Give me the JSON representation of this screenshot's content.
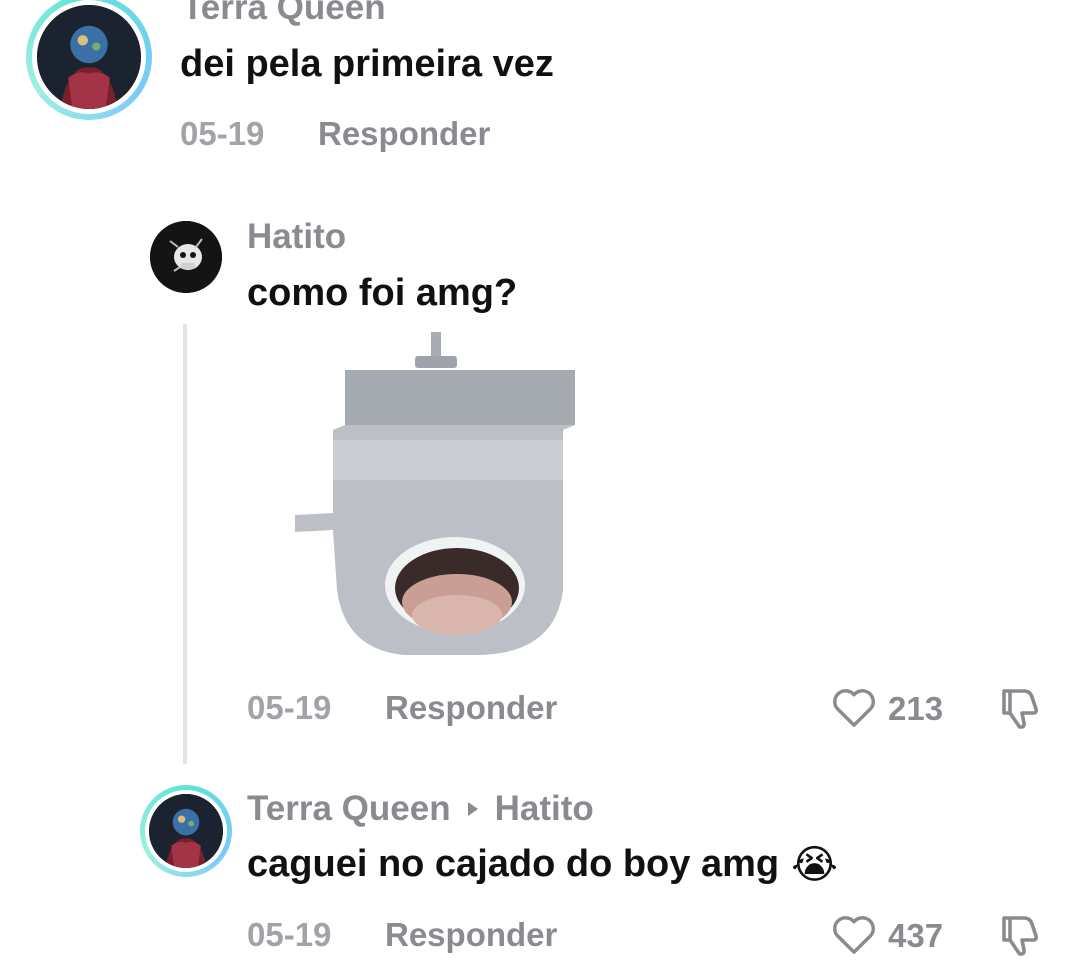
{
  "comments": [
    {
      "author": "Terra Queen",
      "text": "dei pela primeira vez",
      "date": "05-19",
      "reply_label": "Responder"
    },
    {
      "author": "Hatito",
      "text": "como foi amg?",
      "date": "05-19",
      "reply_label": "Responder",
      "likes": "213"
    },
    {
      "author": "Terra Queen",
      "reply_to": "Hatito",
      "text": "caguei no cajado do boy amg",
      "emoji": "😭",
      "date": "05-19",
      "reply_label": "Responder",
      "likes": "437"
    }
  ],
  "icons": {
    "like": "heart-outline-icon",
    "dislike": "thumbs-down-outline-icon",
    "reply_arrow": "triangle-right-icon"
  },
  "colors": {
    "avatar_ring": "#5fe3d9",
    "muted_text": "#8a8b91"
  }
}
